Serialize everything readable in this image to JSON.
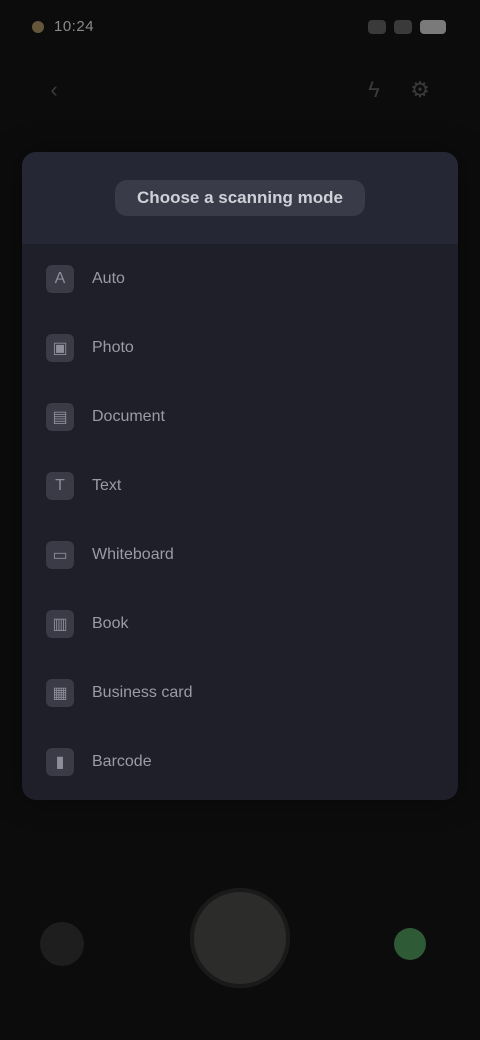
{
  "status_bar": {
    "time": "10:24",
    "icons": [
      "dot-icon",
      "signal-icon",
      "wifi-icon",
      "battery-icon"
    ]
  },
  "top_bar": {
    "left_icon": "back-icon",
    "right_icons": [
      "flash-icon",
      "settings-icon"
    ]
  },
  "panel": {
    "title": "Choose a scanning mode",
    "items": [
      {
        "label": "Auto",
        "icon": "auto-icon"
      },
      {
        "label": "Photo",
        "icon": "photo-icon"
      },
      {
        "label": "Document",
        "icon": "document-icon"
      },
      {
        "label": "Text",
        "icon": "text-icon"
      },
      {
        "label": "Whiteboard",
        "icon": "whiteboard-icon"
      },
      {
        "label": "Book",
        "icon": "book-icon"
      },
      {
        "label": "Business card",
        "icon": "business-card-icon"
      },
      {
        "label": "Barcode",
        "icon": "barcode-icon"
      }
    ]
  },
  "mode_caption": "",
  "bottom_bar": {
    "switch_label": "",
    "accent_color": "#2e5a36"
  }
}
